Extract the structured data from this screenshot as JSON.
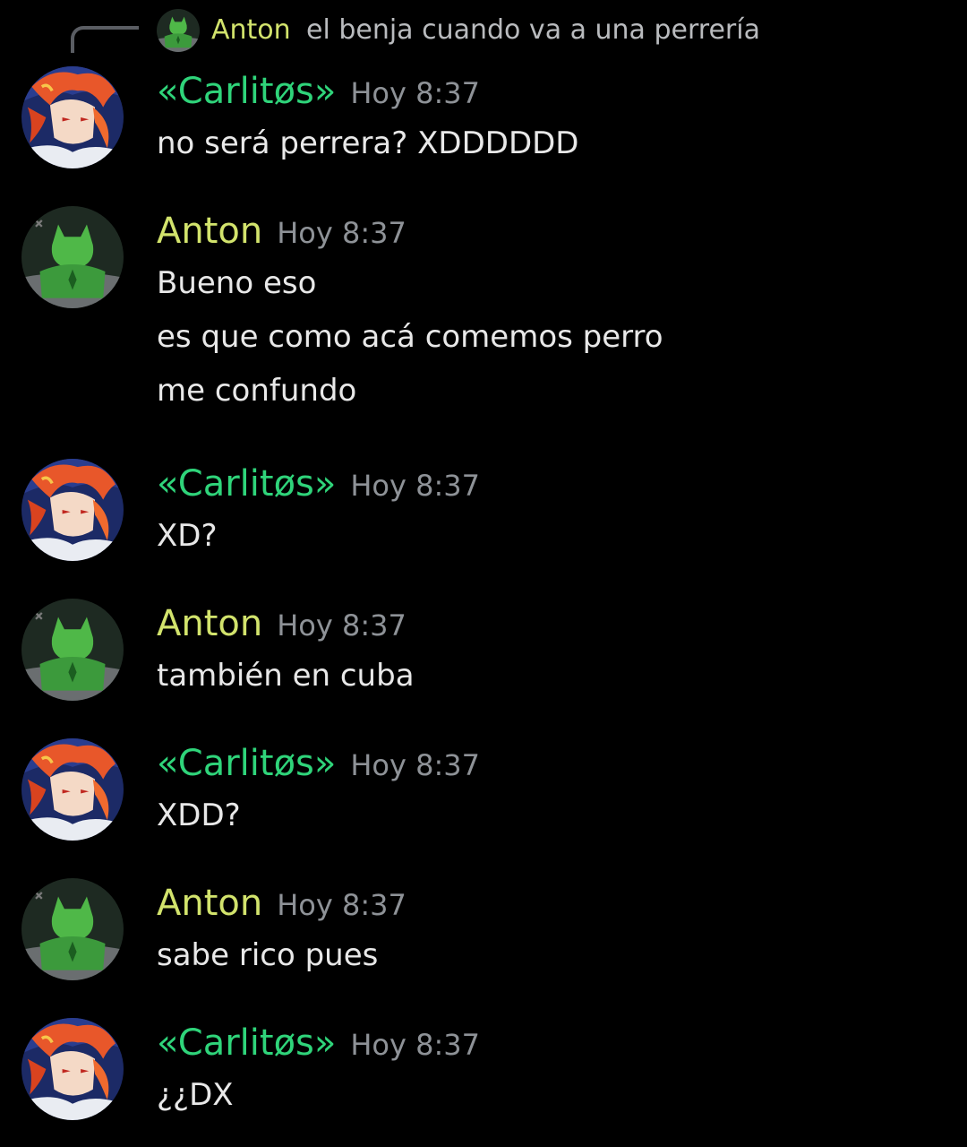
{
  "reply": {
    "author": "Anton",
    "text": "el benja cuando va a una perrería"
  },
  "messages": [
    {
      "author": "«Carlitøs»",
      "time": "Hoy 8:37",
      "lines": [
        "no será perrera? XDDDDDD"
      ]
    },
    {
      "author": "Anton",
      "time": "Hoy 8:37",
      "lines": [
        "Bueno eso",
        "es que como acá comemos perro",
        "me confundo"
      ]
    },
    {
      "author": "«Carlitøs»",
      "time": "Hoy 8:37",
      "lines": [
        "XD?"
      ]
    },
    {
      "author": "Anton",
      "time": "Hoy 8:37",
      "lines": [
        "también en cuba"
      ]
    },
    {
      "author": "«Carlitøs»",
      "time": "Hoy 8:37",
      "lines": [
        "XDD?"
      ]
    },
    {
      "author": "Anton",
      "time": "Hoy 8:37",
      "lines": [
        "sabe rico pues"
      ]
    },
    {
      "author": "«Carlitøs»",
      "time": "Hoy 8:37",
      "lines": [
        "¿¿DX"
      ]
    }
  ],
  "colors": {
    "background": "#000000",
    "carlitos_name": "#2fd47a",
    "anton_name": "#d2e36c",
    "timestamp": "#8e9297",
    "message_text": "#e8e8e8"
  },
  "icons": {
    "carlitos_avatar": "anime-flame-hair-avatar",
    "anton_avatar": "green-masked-hero-avatar"
  }
}
